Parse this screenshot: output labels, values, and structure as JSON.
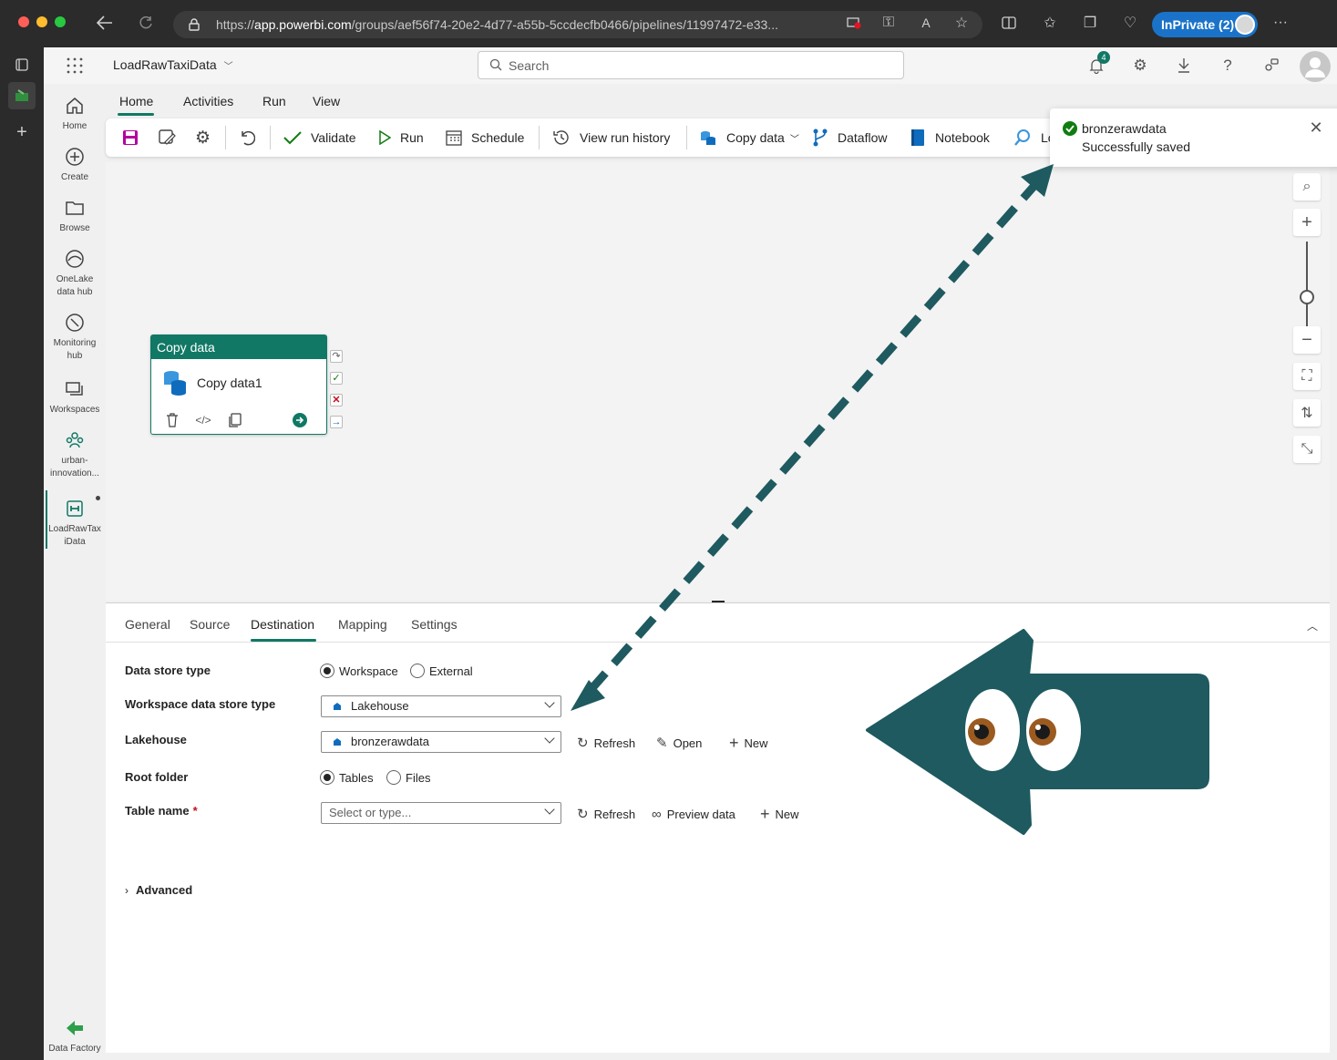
{
  "browser": {
    "url_prefix": "https://",
    "url_host": "app.powerbi.com",
    "url_path": "/groups/aef56f74-20e2-4d77-a55b-5ccdecfb0466/pipelines/11997472-e33...",
    "inprivate_label": "InPrivate (2)"
  },
  "topbar": {
    "artifact_name": "LoadRawTaxiData",
    "search_placeholder": "Search",
    "notification_count": "4"
  },
  "leftnav": {
    "home": "Home",
    "create": "Create",
    "browse": "Browse",
    "onelake_1": "OneLake",
    "onelake_2": "data hub",
    "monitoring_1": "Monitoring",
    "monitoring_2": "hub",
    "workspaces": "Workspaces",
    "workspace_1": "urban-",
    "workspace_2": "innovation...",
    "current_1": "LoadRawTax",
    "current_2": "iData",
    "product": "Data Factory"
  },
  "ribbon": {
    "tabs": [
      "Home",
      "Activities",
      "Run",
      "View"
    ],
    "validate": "Validate",
    "run": "Run",
    "schedule": "Schedule",
    "view_run_history": "View run history",
    "copy_data": "Copy data",
    "dataflow": "Dataflow",
    "notebook": "Notebook",
    "lookup_partial": "Lo"
  },
  "canvas": {
    "activity_type": "Copy data",
    "activity_name": "Copy data1"
  },
  "toast": {
    "title": "bronzerawdata",
    "message": "Successfully saved"
  },
  "panel": {
    "tabs": [
      "General",
      "Source",
      "Destination",
      "Mapping",
      "Settings"
    ],
    "active_tab": "Destination",
    "data_store_type_label": "Data store type",
    "data_store_options": [
      "Workspace",
      "External"
    ],
    "data_store_selected": "Workspace",
    "ws_store_type_label": "Workspace data store type",
    "ws_store_type_value": "Lakehouse",
    "lakehouse_label": "Lakehouse",
    "lakehouse_value": "bronzerawdata",
    "root_folder_label": "Root folder",
    "root_folder_options": [
      "Tables",
      "Files"
    ],
    "root_folder_selected": "Tables",
    "table_name_label": "Table name",
    "table_name_required": "*",
    "table_name_placeholder": "Select or type...",
    "refresh": "Refresh",
    "open": "Open",
    "new": "New",
    "preview_data": "Preview data",
    "advanced": "Advanced"
  },
  "colors": {
    "accent": "#117865",
    "annotation": "#1e5a5f",
    "success": "#107c10"
  }
}
